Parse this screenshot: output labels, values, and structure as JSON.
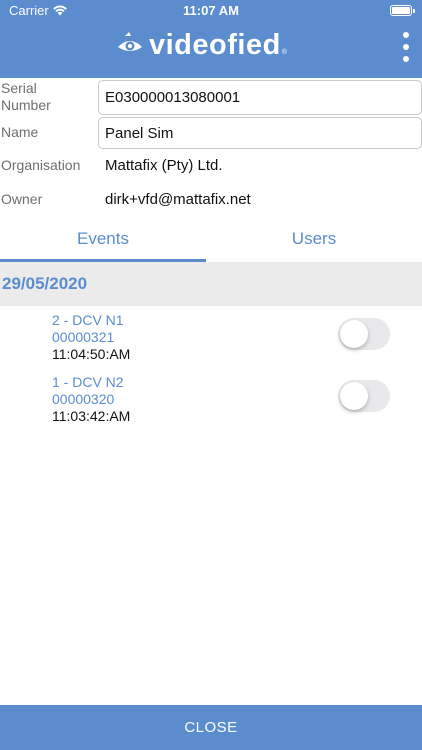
{
  "status_bar": {
    "carrier": "Carrier",
    "time": "11:07 AM"
  },
  "header": {
    "logo_text": "videofied",
    "logo_reg": "®"
  },
  "fields": {
    "serial_label": "Serial\nNumber",
    "serial_value": "E030000013080001",
    "name_label": "Name",
    "name_value": "Panel Sim",
    "organisation_label": "Organisation",
    "organisation_value": "Mattafix (Pty) Ltd.",
    "owner_label": "Owner",
    "owner_value": "dirk+vfd@mattafix.net"
  },
  "tabs": [
    {
      "label": "Events",
      "active": true
    },
    {
      "label": "Users",
      "active": false
    }
  ],
  "events_section": {
    "date": "29/05/2020",
    "items": [
      {
        "title": "2 - DCV N1",
        "id": "00000321",
        "time": "11:04:50:AM",
        "enabled": false
      },
      {
        "title": "1 - DCV N2",
        "id": "00000320",
        "time": "11:03:42:AM",
        "enabled": false
      }
    ]
  },
  "footer": {
    "close_label": "CLOSE"
  },
  "colors": {
    "accent": "#5b8cce",
    "section_bg": "#ebebeb",
    "toggle_off": "#e9e9eb"
  },
  "icons": [
    "wifi-icon",
    "battery-icon",
    "videofied-eye-icon",
    "more-vertical-icon"
  ]
}
